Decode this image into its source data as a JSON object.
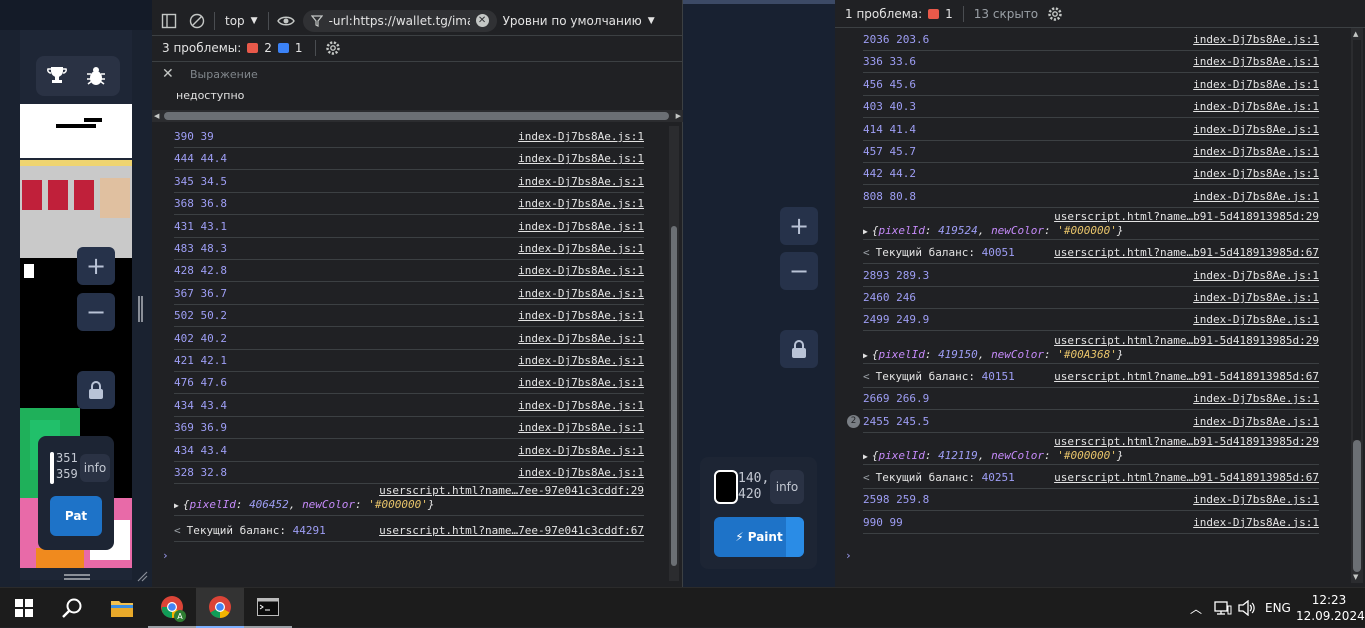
{
  "left_panel": {
    "buttons": {
      "plus": "+",
      "minus": "−"
    },
    "coords": "351,\n359",
    "info_label": "info",
    "paint_label": "Paint",
    "paint_overlay": "Pat"
  },
  "devtools_left": {
    "toolbar": {
      "context": "top",
      "filter": "-url:https://wallet.tg/images/",
      "levels": "Уровни по умолчанию"
    },
    "issues": {
      "label": "3 проблемы:",
      "errors": "2",
      "info": "1"
    },
    "expression": {
      "placeholder": "Выражение",
      "value": "недоступно"
    },
    "log_rows": [
      {
        "msg": "390 39",
        "src": "index-Dj7bs8Ae.js:1"
      },
      {
        "msg": "444 44.4",
        "src": "index-Dj7bs8Ae.js:1"
      },
      {
        "msg": "345 34.5",
        "src": "index-Dj7bs8Ae.js:1"
      },
      {
        "msg": "368 36.8",
        "src": "index-Dj7bs8Ae.js:1"
      },
      {
        "msg": "431 43.1",
        "src": "index-Dj7bs8Ae.js:1"
      },
      {
        "msg": "483 48.3",
        "src": "index-Dj7bs8Ae.js:1"
      },
      {
        "msg": "428 42.8",
        "src": "index-Dj7bs8Ae.js:1"
      },
      {
        "msg": "367 36.7",
        "src": "index-Dj7bs8Ae.js:1"
      },
      {
        "msg": "502 50.2",
        "src": "index-Dj7bs8Ae.js:1"
      },
      {
        "msg": "402 40.2",
        "src": "index-Dj7bs8Ae.js:1"
      },
      {
        "msg": "421 42.1",
        "src": "index-Dj7bs8Ae.js:1"
      },
      {
        "msg": "476 47.6",
        "src": "index-Dj7bs8Ae.js:1"
      },
      {
        "msg": "434 43.4",
        "src": "index-Dj7bs8Ae.js:1"
      },
      {
        "msg": "369 36.9",
        "src": "index-Dj7bs8Ae.js:1"
      },
      {
        "msg": "434 43.4",
        "src": "index-Dj7bs8Ae.js:1"
      },
      {
        "msg": "328 32.8",
        "src": "index-Dj7bs8Ae.js:1"
      }
    ],
    "obj_src": "userscript.html?name…7ee-97e041c3cddf:29",
    "obj": {
      "k1": "pixelId",
      "v1": "406452",
      "k2": "newColor",
      "v2": "'#000000'"
    },
    "balance": {
      "label": "Текущий баланс:",
      "value": "44291",
      "src": "userscript.html?name…7ee-97e041c3cddf:67"
    }
  },
  "middle_panel": {
    "buttons": {
      "plus": "+",
      "minus": "−"
    },
    "coords": "140,\n420",
    "info_label": "info",
    "paint_label": "Paint"
  },
  "devtools_right": {
    "issues": {
      "label": "1 проблема:",
      "errors": "1",
      "hidden": "13 скрыто"
    },
    "entries": [
      {
        "type": "log",
        "msg": "2036 203.6",
        "src": "index-Dj7bs8Ae.js:1"
      },
      {
        "type": "log",
        "msg": "336 33.6",
        "src": "index-Dj7bs8Ae.js:1"
      },
      {
        "type": "log",
        "msg": "456 45.6",
        "src": "index-Dj7bs8Ae.js:1"
      },
      {
        "type": "log",
        "msg": "403 40.3",
        "src": "index-Dj7bs8Ae.js:1"
      },
      {
        "type": "log",
        "msg": "414 41.4",
        "src": "index-Dj7bs8Ae.js:1"
      },
      {
        "type": "log",
        "msg": "457 45.7",
        "src": "index-Dj7bs8Ae.js:1"
      },
      {
        "type": "log",
        "msg": "442 44.2",
        "src": "index-Dj7bs8Ae.js:1"
      },
      {
        "type": "log",
        "msg": "808 80.8",
        "src": "index-Dj7bs8Ae.js:1"
      },
      {
        "type": "obj",
        "src": "userscript.html?name…b91-5d418913985d:29",
        "k1": "pixelId",
        "v1": "419524",
        "k2": "newColor",
        "v2": "'#000000'"
      },
      {
        "type": "bal",
        "label": "Текущий баланс:",
        "value": "40051",
        "src": "userscript.html?name…b91-5d418913985d:67"
      },
      {
        "type": "log",
        "msg": "2893 289.3",
        "src": "index-Dj7bs8Ae.js:1"
      },
      {
        "type": "log",
        "msg": "2460 246",
        "src": "index-Dj7bs8Ae.js:1"
      },
      {
        "type": "log",
        "msg": "2499 249.9",
        "src": "index-Dj7bs8Ae.js:1"
      },
      {
        "type": "obj",
        "src": "userscript.html?name…b91-5d418913985d:29",
        "k1": "pixelId",
        "v1": "419150",
        "k2": "newColor",
        "v2": "'#00A368'"
      },
      {
        "type": "bal",
        "label": "Текущий баланс:",
        "value": "40151",
        "src": "userscript.html?name…b91-5d418913985d:67"
      },
      {
        "type": "log",
        "msg": "2669 266.9",
        "src": "index-Dj7bs8Ae.js:1"
      },
      {
        "type": "log",
        "msg": "2455 245.5",
        "src": "index-Dj7bs8Ae.js:1",
        "count": "2"
      },
      {
        "type": "obj",
        "src": "userscript.html?name…b91-5d418913985d:29",
        "k1": "pixelId",
        "v1": "412119",
        "k2": "newColor",
        "v2": "'#000000'"
      },
      {
        "type": "bal",
        "label": "Текущий баланс:",
        "value": "40251",
        "src": "userscript.html?name…b91-5d418913985d:67"
      },
      {
        "type": "log",
        "msg": "2598 259.8",
        "src": "index-Dj7bs8Ae.js:1"
      },
      {
        "type": "log",
        "msg": "990 99",
        "src": "index-Dj7bs8Ae.js:1"
      }
    ]
  },
  "taskbar": {
    "language": "ENG",
    "time": "12:23",
    "date": "12.09.2024",
    "chrome_badge": "A"
  },
  "colors": {
    "link_num": "#9e9ef5",
    "paint_button": "#1e73c8",
    "error_badge": "#e8594a",
    "info_badge": "#3b82f6"
  }
}
